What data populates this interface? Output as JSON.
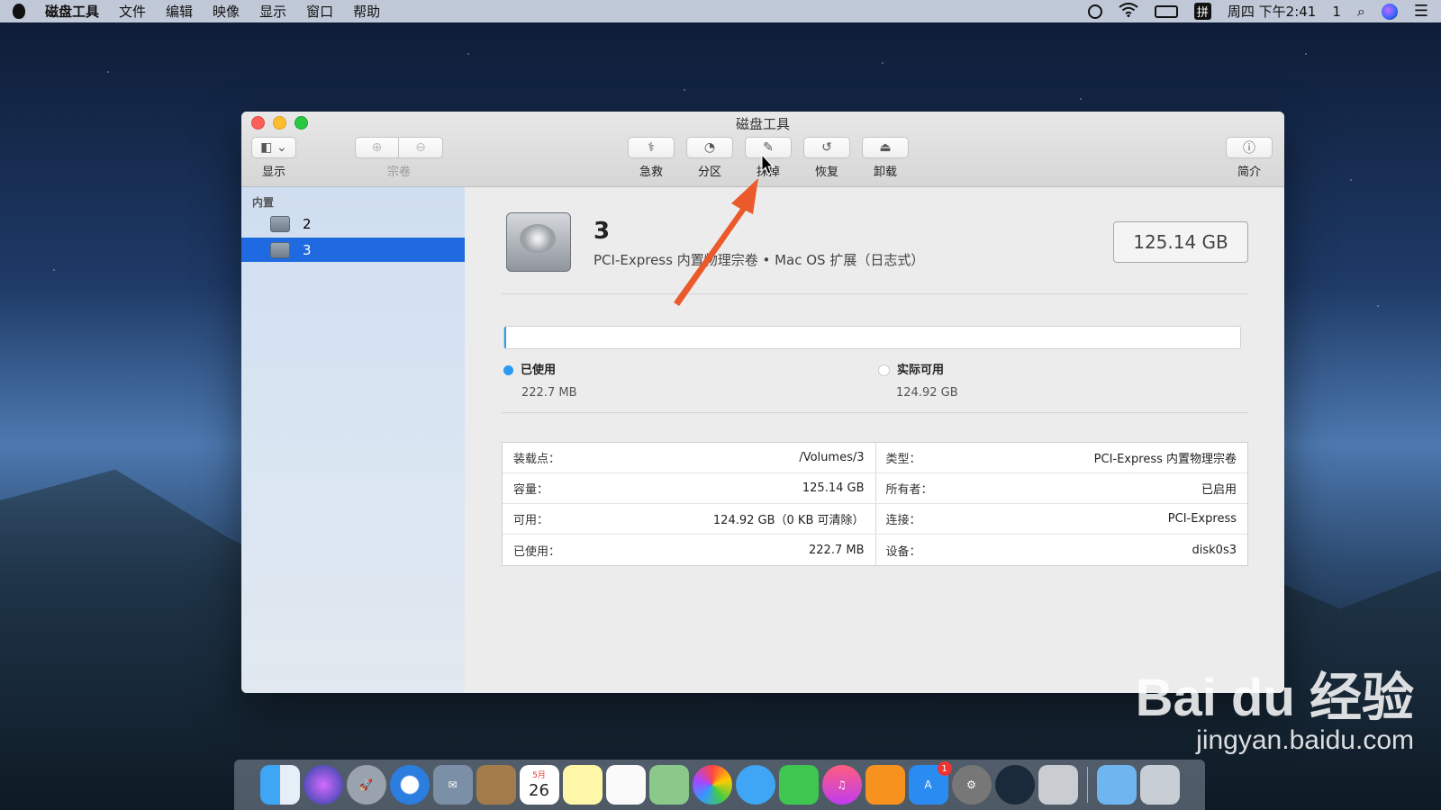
{
  "menubar": {
    "app_name": "磁盘工具",
    "menus": [
      "文件",
      "编辑",
      "映像",
      "显示",
      "窗口",
      "帮助"
    ],
    "clock": "周四 下午2:41",
    "badge": "1",
    "input_method": "拼"
  },
  "window": {
    "title": "磁盘工具",
    "toolbar": {
      "view_label": "显示",
      "volume_label": "宗卷",
      "first_aid_label": "急救",
      "partition_label": "分区",
      "erase_label": "抹掉",
      "restore_label": "恢复",
      "unmount_label": "卸载",
      "info_label": "简介"
    },
    "sidebar": {
      "section": "内置",
      "items": [
        {
          "label": "2"
        },
        {
          "label": "3"
        }
      ]
    },
    "volume": {
      "name": "3",
      "description": "PCI-Express 内置物理宗卷 • Mac OS 扩展（日志式）",
      "capacity": "125.14 GB",
      "used_fraction": 0.0018
    },
    "legend": {
      "used_label": "已使用",
      "used_value": "222.7 MB",
      "free_label": "实际可用",
      "free_value": "124.92 GB",
      "used_color": "#2a9bf0",
      "free_color": "#ffffff"
    },
    "info_left": [
      {
        "k": "装载点：",
        "v": "/Volumes/3"
      },
      {
        "k": "容量：",
        "v": "125.14 GB"
      },
      {
        "k": "可用：",
        "v": "124.92 GB（0 KB 可清除）"
      },
      {
        "k": "已使用：",
        "v": "222.7 MB"
      }
    ],
    "info_right": [
      {
        "k": "类型：",
        "v": "PCI-Express 内置物理宗卷"
      },
      {
        "k": "所有者：",
        "v": "已启用"
      },
      {
        "k": "连接：",
        "v": "PCI-Express"
      },
      {
        "k": "设备：",
        "v": "disk0s3"
      }
    ]
  },
  "dock": {
    "calendar_day": "26",
    "calendar_month": "5月",
    "appstore_badge": "1"
  },
  "watermark": {
    "brand": "Bai du 经验",
    "url": "jingyan.baidu.com"
  }
}
